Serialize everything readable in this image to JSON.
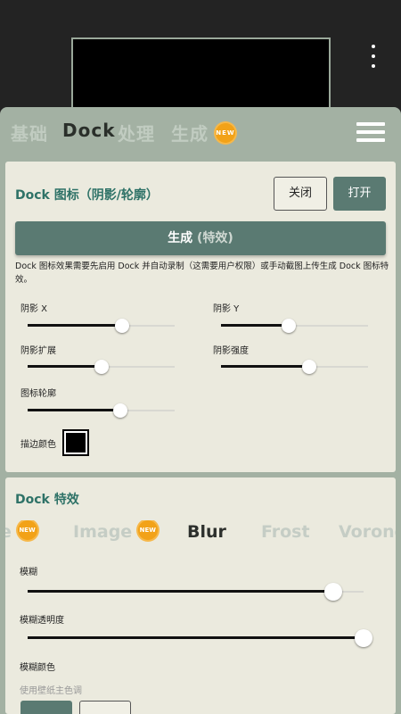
{
  "header": {
    "tabs": [
      {
        "label": "基础",
        "active": false
      },
      {
        "label": "Dock",
        "active": true
      },
      {
        "label": "处理",
        "active": false
      },
      {
        "label": "生成",
        "active": false,
        "badge": "NEW"
      }
    ]
  },
  "dock_icon_card": {
    "title": "Dock 图标（阴影/轮廓）",
    "close_label": "关闭",
    "open_label": "打开",
    "generate_label": "生成",
    "generate_suffix": "(特效)",
    "description": "Dock 图标效果需要先启用 Dock 并自动录制（这需要用户权限）或手动截图上传生成 Dock 图标特效。",
    "sliders": {
      "shadow_x": {
        "label": "阴影 X",
        "value": 0.64
      },
      "shadow_y": {
        "label": "阴影 Y",
        "value": 0.46
      },
      "shadow_spread": {
        "label": "阴影扩展",
        "value": 0.5
      },
      "shadow_strength": {
        "label": "阴影强度",
        "value": 0.6
      },
      "icon_outline": {
        "label": "图标轮廓",
        "value": 0.63
      }
    },
    "stroke_color_label": "描边颜色",
    "stroke_color": "#000000"
  },
  "dock_effects_card": {
    "title": "Dock 特效",
    "effects": [
      {
        "label": "e",
        "badge": "NEW",
        "active": false
      },
      {
        "label": "Image",
        "badge": "NEW",
        "active": false
      },
      {
        "label": "Blur",
        "active": true
      },
      {
        "label": "Frost",
        "active": false
      },
      {
        "label": "Voronoi",
        "active": false
      }
    ],
    "sliders": {
      "blur": {
        "label": "模糊",
        "value": 0.91
      },
      "blur_opacity": {
        "label": "模糊透明度",
        "value": 1.0
      }
    },
    "blur_color_label": "模糊颜色",
    "wallpaper_hint": "使用壁纸主色调"
  },
  "colors": {
    "accent": "#5a7a72",
    "title_teal": "#2e7267",
    "panel": "#a3b1a3",
    "card": "#ebeade",
    "badge": "#f2a218"
  }
}
